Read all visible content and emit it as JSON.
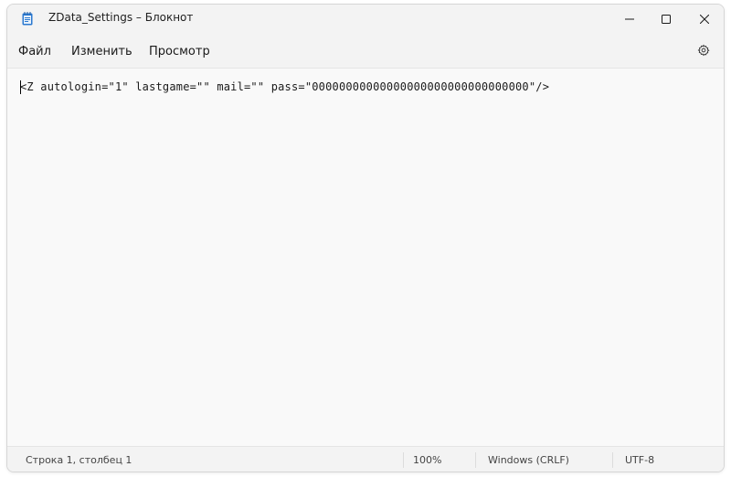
{
  "window": {
    "title": "ZData_Settings – Блокнот"
  },
  "menu": {
    "file": "Файл",
    "edit": "Изменить",
    "view": "Просмотр"
  },
  "editor": {
    "content": "<Z autologin=\"1\" lastgame=\"\" mail=\"\" pass=\"00000000000000000000000000000000\"/>"
  },
  "status": {
    "position": "Строка 1, столбец 1",
    "zoom": "100%",
    "line_ending": "Windows (CRLF)",
    "encoding": "UTF-8"
  },
  "icons": {
    "app": "notepad-icon",
    "minimize": "minimize-icon",
    "maximize": "maximize-icon",
    "close": "close-icon",
    "settings": "gear-icon"
  },
  "colors": {
    "background": "#f9f9f9",
    "chrome": "#f3f3f3",
    "app_icon": "#2b79d0"
  }
}
